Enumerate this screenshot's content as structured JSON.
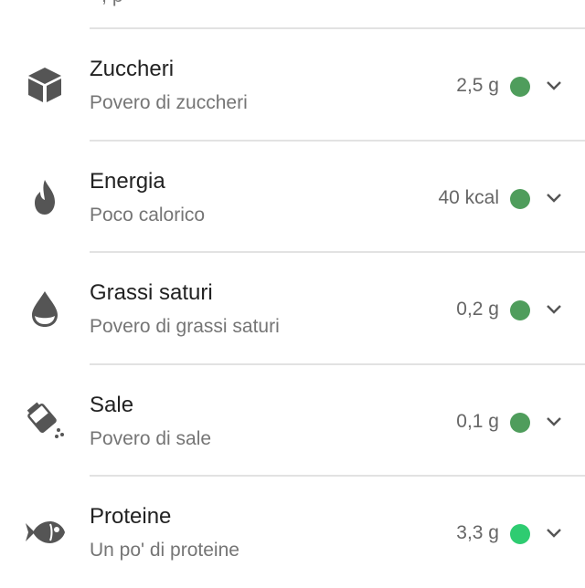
{
  "top_snippet": "• , p",
  "items": [
    {
      "title": "Zuccheri",
      "subtitle": "Povero di zuccheri",
      "value": "2,5 g",
      "dot_color": "#4f9d5c",
      "icon": "sugar-cube-icon"
    },
    {
      "title": "Energia",
      "subtitle": "Poco calorico",
      "value": "40 kcal",
      "dot_color": "#4f9d5c",
      "icon": "flame-icon"
    },
    {
      "title": "Grassi saturi",
      "subtitle": "Povero di grassi saturi",
      "value": "0,2 g",
      "dot_color": "#4f9d5c",
      "icon": "fat-drop-icon"
    },
    {
      "title": "Sale",
      "subtitle": "Povero di sale",
      "value": "0,1 g",
      "dot_color": "#4f9d5c",
      "icon": "salt-shaker-icon"
    },
    {
      "title": "Proteine",
      "subtitle": "Un po' di proteine",
      "value": "3,3 g",
      "dot_color": "#2ecc71",
      "icon": "fish-icon"
    }
  ]
}
